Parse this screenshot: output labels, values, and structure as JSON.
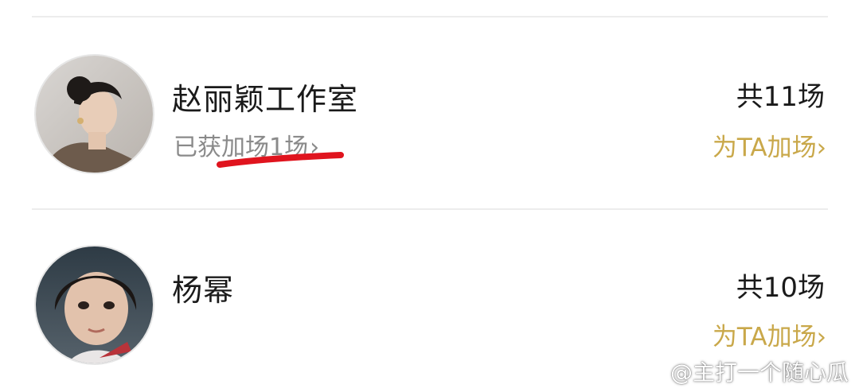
{
  "list": {
    "items": [
      {
        "name": "赵丽颖工作室",
        "bonus_text": "已获加场1场",
        "bonus_chevron": "›",
        "count_text": "共11场",
        "action_label": "为TA加场",
        "action_chevron": "›"
      },
      {
        "name": "杨幂",
        "count_text": "共10场",
        "action_label": "为TA加场",
        "action_chevron": "›"
      }
    ]
  },
  "watermark": {
    "icon": "weibo-icon",
    "text": "@主打一个随心瓜"
  },
  "colors": {
    "accent": "#c9a84a",
    "highlight_mark": "#e0141e",
    "divider": "#ececec"
  }
}
